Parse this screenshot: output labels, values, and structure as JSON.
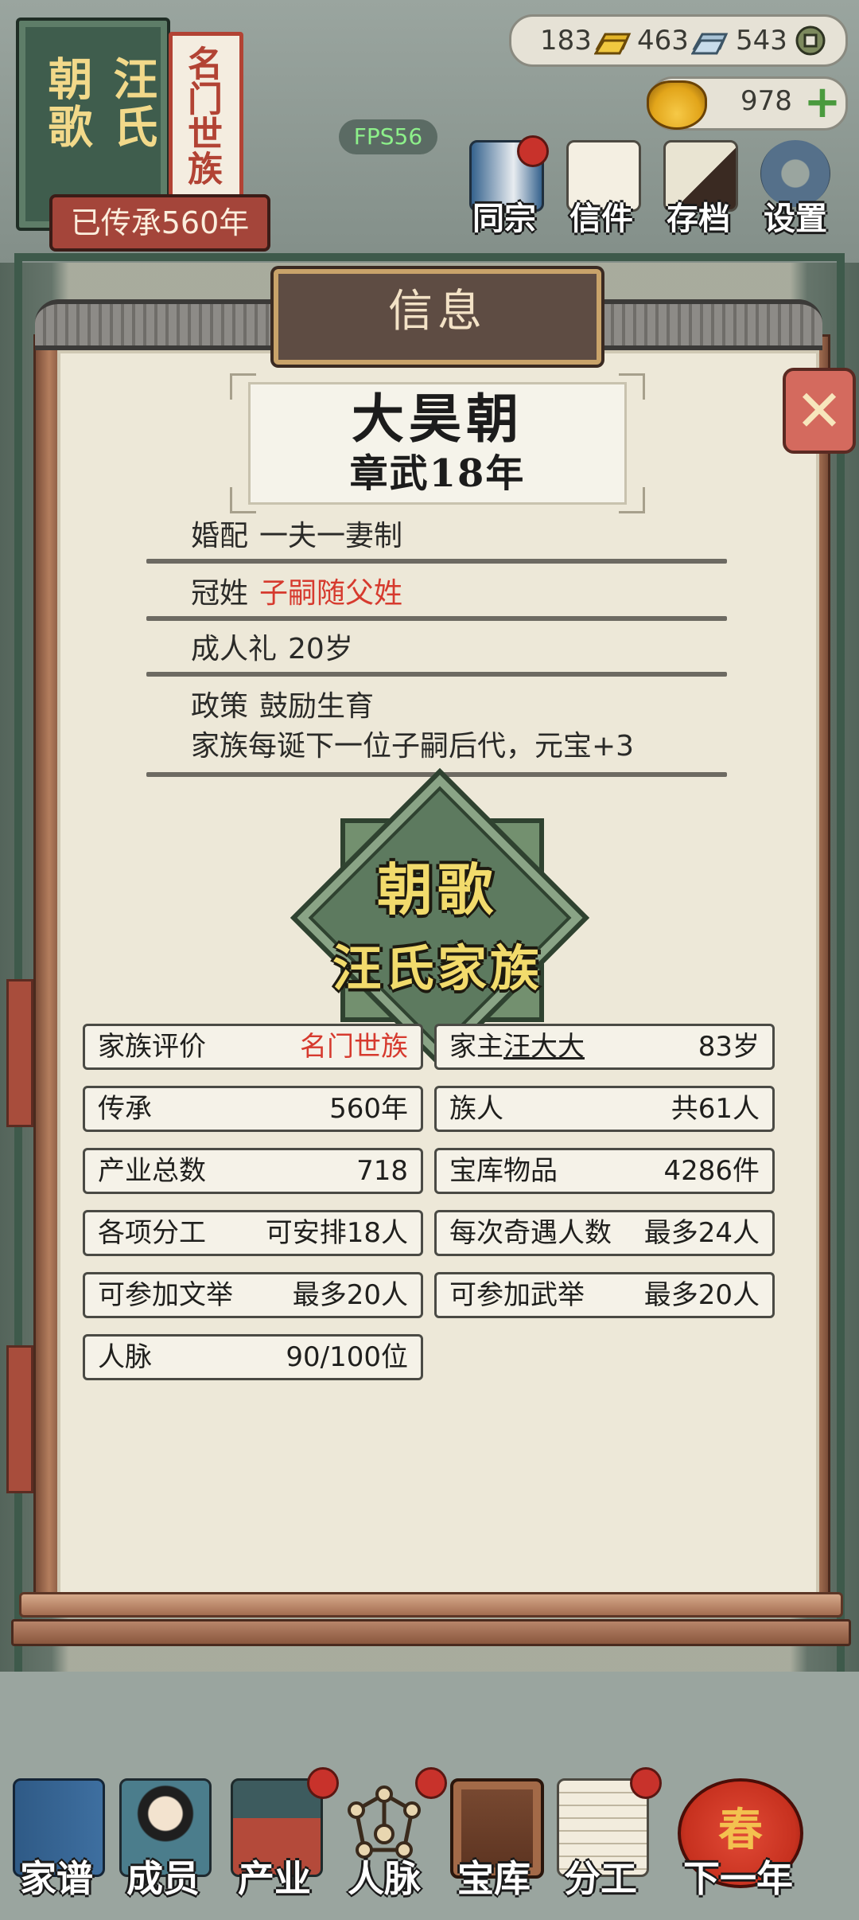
{
  "clan": {
    "place": "朝歌",
    "surname": "汪氏",
    "rank": "名门世族",
    "inheritance_banner": "已传承560年"
  },
  "currency": {
    "gold_bars": "183",
    "silver_bars": "463",
    "coins": "543",
    "ingots": "978"
  },
  "fps": "FPS56",
  "top_nav": [
    {
      "label": "同宗",
      "icon": "clan-book-icon"
    },
    {
      "label": "信件",
      "icon": "letter-icon"
    },
    {
      "label": "存档",
      "icon": "brush-scroll-icon"
    },
    {
      "label": "设置",
      "icon": "gear-icon"
    }
  ],
  "modal": {
    "title": "信息",
    "dynasty": "大昊朝",
    "era_year": "章武18年",
    "rules": [
      {
        "label": "婚配",
        "value": "一夫一妻制",
        "highlight": false
      },
      {
        "label": "冠姓",
        "value": "子嗣随父姓",
        "highlight": true
      },
      {
        "label": "成人礼",
        "value": "20岁",
        "highlight": false
      },
      {
        "label": "政策",
        "value": "鼓励生育",
        "note": "家族每诞下一位子嗣后代，元宝+3",
        "highlight": false
      }
    ],
    "emblem": {
      "line1": "朝歌",
      "line2": "汪氏家族"
    },
    "stats": [
      {
        "label": "家族评价",
        "value": "名门世族",
        "highlight": true
      },
      {
        "label": "家主",
        "name": "汪大大",
        "value": "83岁"
      },
      {
        "label": "传承",
        "value": "560年"
      },
      {
        "label": "族人",
        "value": "共61人"
      },
      {
        "label": "产业总数",
        "value": "718"
      },
      {
        "label": "宝库物品",
        "value": "4286件"
      },
      {
        "label": "各项分工",
        "value": "可安排18人"
      },
      {
        "label": "每次奇遇人数",
        "value": "最多24人"
      },
      {
        "label": "可参加文举",
        "value": "最多20人"
      },
      {
        "label": "可参加武举",
        "value": "最多20人"
      },
      {
        "label": "人脉",
        "value": "90/100位"
      }
    ]
  },
  "bottom_nav": [
    {
      "label": "家谱",
      "icon": "genealogy-book-icon"
    },
    {
      "label": "成员",
      "icon": "member-portrait-icon"
    },
    {
      "label": "产业",
      "icon": "pavilion-icon"
    },
    {
      "label": "人脉",
      "icon": "network-icon"
    },
    {
      "label": "宝库",
      "icon": "treasure-chest-icon"
    },
    {
      "label": "分工",
      "icon": "scroll-icon"
    },
    {
      "label": "下一年",
      "icon": "lantern-icon",
      "lantern_text": "春"
    }
  ],
  "colors": {
    "accent_red": "#d63a2e",
    "fps_green": "#8df08a",
    "emblem_gold": "#f2db6c"
  }
}
